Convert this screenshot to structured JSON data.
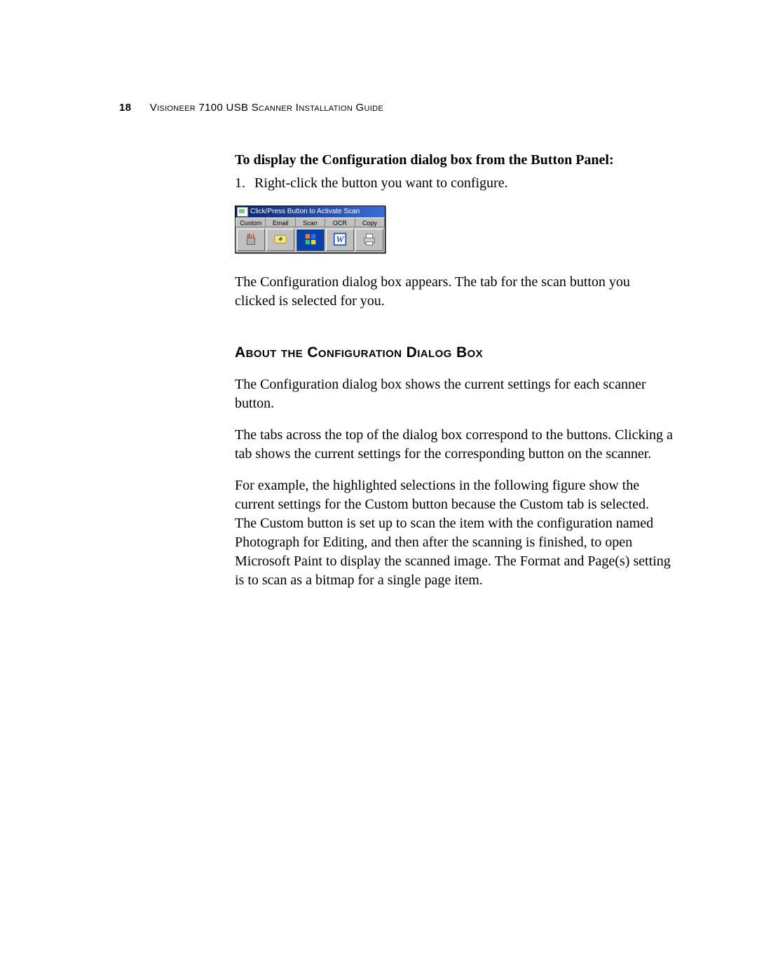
{
  "header": {
    "page_number": "18",
    "title": "Visioneer 7100 USB Scanner Installation Guide"
  },
  "content": {
    "subheading": "To display the Configuration dialog box from the Button Panel:",
    "step1_num": "1.",
    "step1_text": "Right-click the button you want to configure.",
    "after_panel": "The Configuration dialog box appears. The tab for the scan button you clicked is selected for you.",
    "section_heading": "About the Configuration Dialog Box",
    "p1": "The Configuration dialog box shows the current settings for each scanner button.",
    "p2": "The tabs across the top of the dialog box correspond to the buttons. Clicking a tab shows the current settings for the corresponding button on the scanner.",
    "p3": "For example, the highlighted selections in the following figure show the current settings for the Custom button because the Custom tab is selected. The Custom button is set up to scan the item with the configuration named Photograph for Editing, and then after the scanning is finished, to open Microsoft Paint to display the scanned image. The Format and Page(s) setting is to scan as a bitmap for a single page item."
  },
  "button_panel": {
    "title": "Click/Press Button to Activate Scan",
    "tabs": [
      "Custom",
      "Email",
      "Scan",
      "OCR",
      "Copy"
    ],
    "icons": [
      "paint-cup-icon",
      "email-icon",
      "scan-app-icon",
      "word-icon",
      "printer-icon"
    ]
  }
}
